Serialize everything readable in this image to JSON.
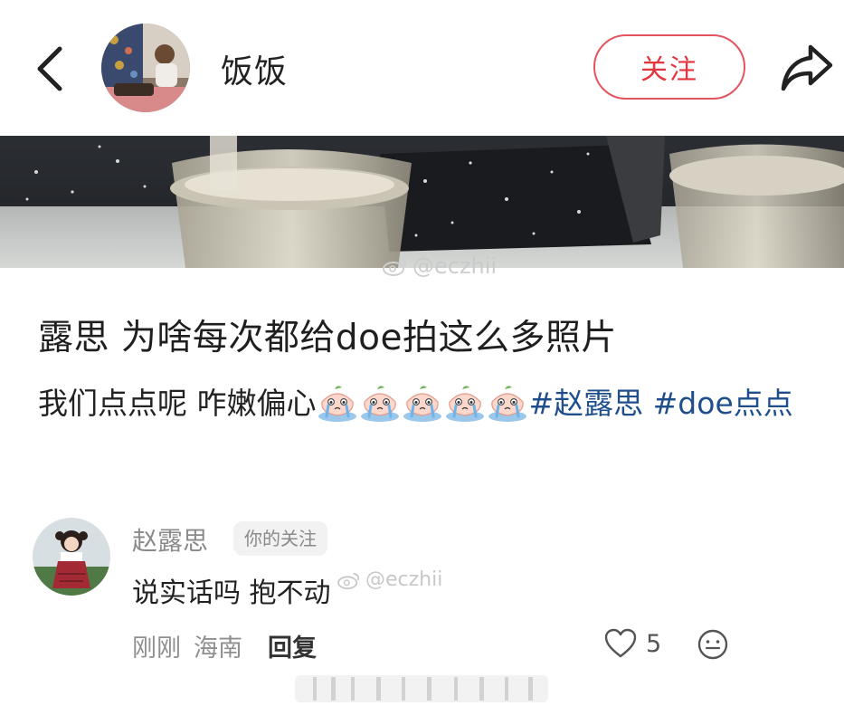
{
  "header": {
    "back_icon": "chevron-left-icon",
    "username": "饭饭",
    "follow_label": "关注",
    "share_icon": "share-icon",
    "accent_color": "#e3353f"
  },
  "banner": {
    "watermark": "@eczhii"
  },
  "post": {
    "title": "露思 为啥每次都给doe拍这么多照片",
    "body_text": "我们点点呢 咋嫩偏心",
    "emoji_name": "crying-peach-emoji",
    "emoji_count": 5,
    "tags": [
      "#赵露思",
      "#doe点点"
    ],
    "tag_color": "#1e4f8c"
  },
  "comment": {
    "author": "赵露思",
    "badge": "你的关注",
    "text": "说实话吗 抱不动",
    "watermark": "@eczhii",
    "time": "刚刚",
    "location": "海南",
    "reply_label": "回复",
    "like_count": "5",
    "like_icon": "heart-icon",
    "reaction_icon": "smile-icon"
  }
}
